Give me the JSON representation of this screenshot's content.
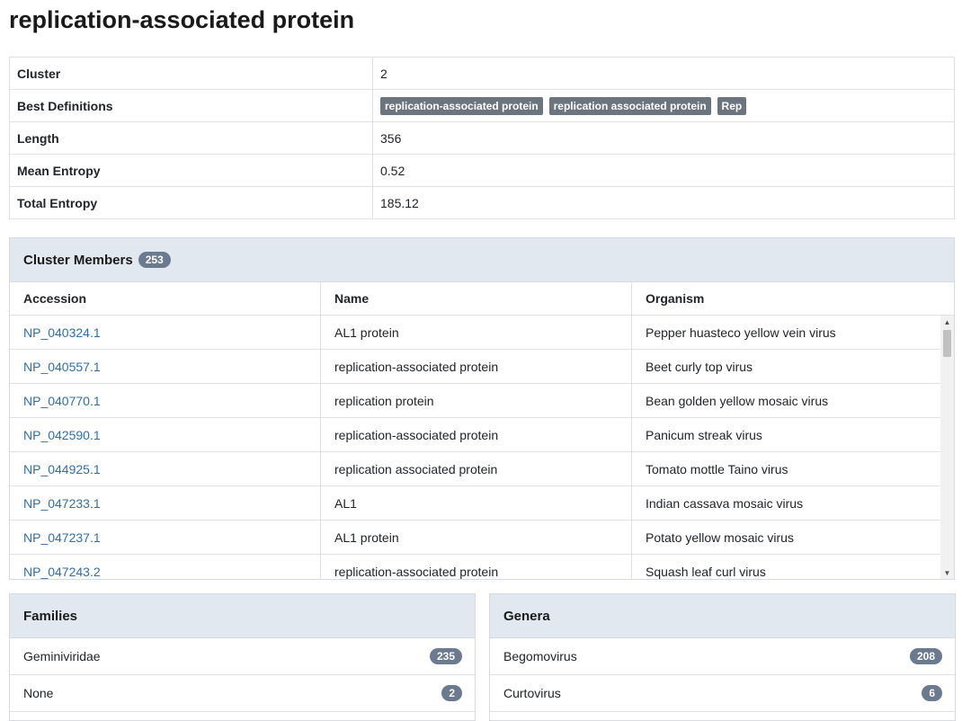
{
  "title": "replication-associated protein",
  "properties": {
    "cluster": {
      "label": "Cluster",
      "value": "2"
    },
    "best_definitions": {
      "label": "Best Definitions",
      "tags": [
        "replication-associated protein",
        "replication associated protein",
        "Rep"
      ]
    },
    "length": {
      "label": "Length",
      "value": "356"
    },
    "mean_entropy": {
      "label": "Mean Entropy",
      "value": "0.52"
    },
    "total_entropy": {
      "label": "Total Entropy",
      "value": "185.12"
    }
  },
  "members": {
    "title": "Cluster Members",
    "count": "253",
    "columns": [
      "Accession",
      "Name",
      "Organism"
    ],
    "rows": [
      {
        "accession": "NP_040324.1",
        "name": "AL1 protein",
        "organism": "Pepper huasteco yellow vein virus"
      },
      {
        "accession": "NP_040557.1",
        "name": "replication-associated protein",
        "organism": "Beet curly top virus"
      },
      {
        "accession": "NP_040770.1",
        "name": "replication protein",
        "organism": "Bean golden yellow mosaic virus"
      },
      {
        "accession": "NP_042590.1",
        "name": "replication-associated protein",
        "organism": "Panicum streak virus"
      },
      {
        "accession": "NP_044925.1",
        "name": "replication associated protein",
        "organism": "Tomato mottle Taino virus"
      },
      {
        "accession": "NP_047233.1",
        "name": "AL1",
        "organism": "Indian cassava mosaic virus"
      },
      {
        "accession": "NP_047237.1",
        "name": "AL1 protein",
        "organism": "Potato yellow mosaic virus"
      },
      {
        "accession": "NP_047243.2",
        "name": "replication-associated protein",
        "organism": "Squash leaf curl virus"
      }
    ]
  },
  "families": {
    "title": "Families",
    "items": [
      {
        "name": "Geminiviridae",
        "count": "235"
      },
      {
        "name": "None",
        "count": "2"
      }
    ]
  },
  "genera": {
    "title": "Genera",
    "items": [
      {
        "name": "Begomovirus",
        "count": "208"
      },
      {
        "name": "Curtovirus",
        "count": "6"
      }
    ]
  }
}
